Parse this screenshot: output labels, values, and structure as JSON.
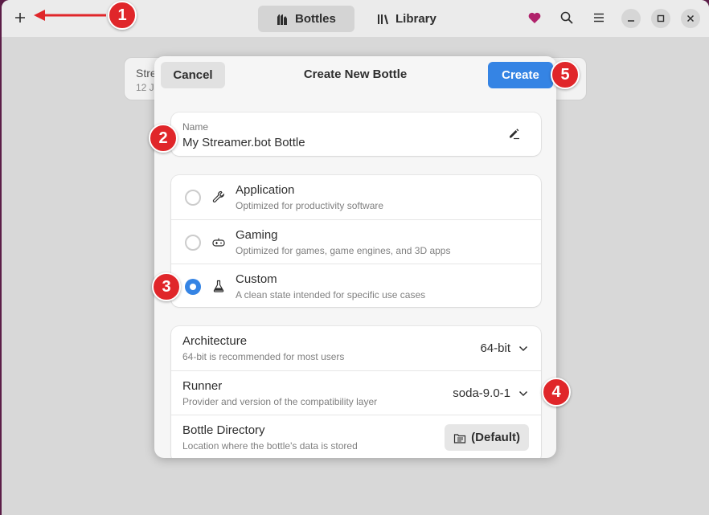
{
  "header": {
    "tabs": [
      {
        "label": "Bottles",
        "active": true
      },
      {
        "label": "Library",
        "active": false
      }
    ]
  },
  "background_card": {
    "title": "Stre",
    "subtitle": "12 J"
  },
  "dialog": {
    "title": "Create New Bottle",
    "cancel_label": "Cancel",
    "create_label": "Create",
    "name": {
      "label": "Name",
      "value": "My Streamer.bot Bottle"
    },
    "environments": [
      {
        "title": "Application",
        "subtitle": "Optimized for productivity software",
        "checked": false,
        "icon": "wrench-icon"
      },
      {
        "title": "Gaming",
        "subtitle": "Optimized for games, game engines, and 3D apps",
        "checked": false,
        "icon": "gamepad-icon"
      },
      {
        "title": "Custom",
        "subtitle": "A clean state intended for specific use cases",
        "checked": true,
        "icon": "flask-icon"
      }
    ],
    "settings": {
      "architecture": {
        "title": "Architecture",
        "subtitle": "64-bit is recommended for most users",
        "value": "64-bit"
      },
      "runner": {
        "title": "Runner",
        "subtitle": "Provider and version of the compatibility layer",
        "value": "soda-9.0-1"
      },
      "directory": {
        "title": "Bottle Directory",
        "subtitle": "Location where the bottle's data is stored",
        "button_label": "(Default)"
      }
    }
  },
  "annotations": {
    "badges": [
      "1",
      "2",
      "3",
      "4",
      "5"
    ]
  },
  "colors": {
    "accent": "#3584e4",
    "badge": "#e0262a",
    "heart": "#b0226b"
  }
}
